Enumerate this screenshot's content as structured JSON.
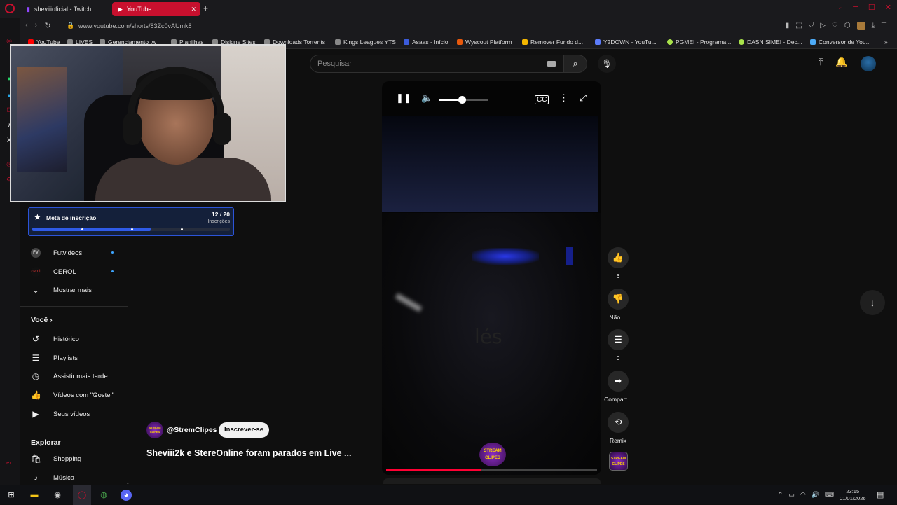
{
  "browser": {
    "tabs": [
      {
        "label": "sheviiioficial - Twitch"
      },
      {
        "label": "YouTube"
      }
    ],
    "url": "www.youtube.com/shorts/83Zc0vAUmk8",
    "bookmarks": [
      {
        "label": "YouTube",
        "color": "#ff0000"
      },
      {
        "label": "LIVES",
        "color": "#888888"
      },
      {
        "label": "Gerenciamento tw",
        "color": "#888888"
      },
      {
        "label": "Planilhas",
        "color": "#888888"
      },
      {
        "label": "Disigne Sites",
        "color": "#888888"
      },
      {
        "label": "Downloads Torrents",
        "color": "#888888"
      },
      {
        "label": "Kings Leagues YTS",
        "color": "#888888"
      },
      {
        "label": "Asaas - Início",
        "color": "#3b5bdb"
      },
      {
        "label": "Wyscout Platform",
        "color": "#e8590c"
      },
      {
        "label": "Remover Fundo d...",
        "color": "#f5b700"
      },
      {
        "label": "Y2DOWN - YouTu...",
        "color": "#5c7cfa"
      },
      {
        "label": "PGMEI - Programa...",
        "color": "#a9e34b"
      },
      {
        "label": "DASN SIMEI - Dec...",
        "color": "#a9e34b"
      },
      {
        "label": "Conversor de You...",
        "color": "#4dabf7"
      }
    ]
  },
  "search": {
    "placeholder": "Pesquisar"
  },
  "meta_widget": {
    "title": "Meta de inscrição",
    "count": "12 / 20",
    "subtitle": "Inscrições",
    "progress": 0.6
  },
  "sidebar": {
    "channels": [
      {
        "label": "Futvideos",
        "icon_text": "FV"
      },
      {
        "label": "CEROL",
        "icon_text": "cerol"
      }
    ],
    "show_more": "Mostrar mais",
    "you_heading": "Você",
    "you_items": [
      {
        "label": "Histórico",
        "icon": "history-icon",
        "glyph": "↺"
      },
      {
        "label": "Playlists",
        "icon": "playlists-icon",
        "glyph": "☰"
      },
      {
        "label": "Assistir mais tarde",
        "icon": "watch-later-icon",
        "glyph": "◷"
      },
      {
        "label": "Vídeos com \"Gostei\"",
        "icon": "liked-icon",
        "glyph": "👍"
      },
      {
        "label": "Seus vídeos",
        "icon": "your-videos-icon",
        "glyph": "▶"
      }
    ],
    "explore_heading": "Explorar",
    "explore_items": [
      {
        "label": "Shopping",
        "icon": "shopping-icon",
        "glyph": "🛍"
      },
      {
        "label": "Música",
        "icon": "music-icon",
        "glyph": "♪"
      }
    ]
  },
  "player": {
    "volume": 0.45,
    "progress": 0.45,
    "overlay_text": "lés",
    "watermark": "STREAM CLIPES"
  },
  "actions": {
    "like_count": "6",
    "dislike_label": "Não ...",
    "comment_count": "0",
    "share_label": "Compart...",
    "remix_label": "Remix"
  },
  "video": {
    "channel": "@StremClipes",
    "subscribe_label": "Inscrever-se",
    "title": "Sheviii2k e StereOnline foram parados em Live ..."
  },
  "taskbar": {
    "time": "23:15",
    "date": "01/01/2026"
  }
}
